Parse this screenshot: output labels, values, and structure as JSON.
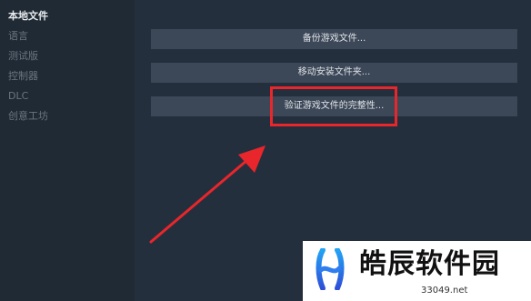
{
  "sidebar": {
    "items": [
      {
        "label": "本地文件",
        "active": true
      },
      {
        "label": "语言"
      },
      {
        "label": "测试版"
      },
      {
        "label": "控制器"
      },
      {
        "label": "DLC"
      },
      {
        "label": "创意工坊"
      }
    ]
  },
  "local_files": {
    "backup_label": "备份游戏文件...",
    "move_label": "移动安装文件夹...",
    "verify_label": "验证游戏文件的完整性..."
  },
  "annotation": {
    "highlight_color": "#e8262b"
  },
  "watermark": {
    "name": "皓辰软件园",
    "url": "33049.net"
  }
}
